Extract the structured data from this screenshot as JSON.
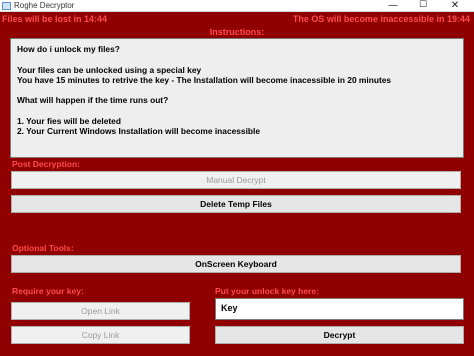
{
  "window": {
    "title": "Roghe Decryptor",
    "minimize_glyph": "—",
    "maximize_glyph": "☐",
    "close_glyph": "✕",
    "app_icon": "window-icon"
  },
  "status": {
    "left": "Files will be lost in 14:44",
    "right": "The OS will become inaccessible in 19:44"
  },
  "instructions": {
    "label": "Instructions:",
    "lines": [
      "How do i unlock my files?",
      "",
      "Your files can be unlocked using a special key",
      "You have 15 minutes to retrive the key - The Installation will become inacessible in 20 minutes",
      "",
      "What will happen if the time runs out?",
      "",
      "1. Your fies will be deleted",
      "2. Your Current Windows Installation will become inacessible"
    ]
  },
  "post_decryption": {
    "label": "Post Decryption:",
    "manual_decrypt": "Manual Decrypt",
    "delete_temp_files": "Delete Temp Files"
  },
  "optional_tools": {
    "label": "Optional Tools:",
    "onscreen_keyboard": "OnScreen Keyboard"
  },
  "require_key": {
    "label": "Require your key:",
    "open_link": "Open Link",
    "copy_link": "Copy Link"
  },
  "unlock": {
    "label": "Put your unlock key here:",
    "key_value": "Key",
    "decrypt": "Decrypt"
  },
  "colors": {
    "background": "#910000",
    "accent_text": "#ff4c4c"
  }
}
